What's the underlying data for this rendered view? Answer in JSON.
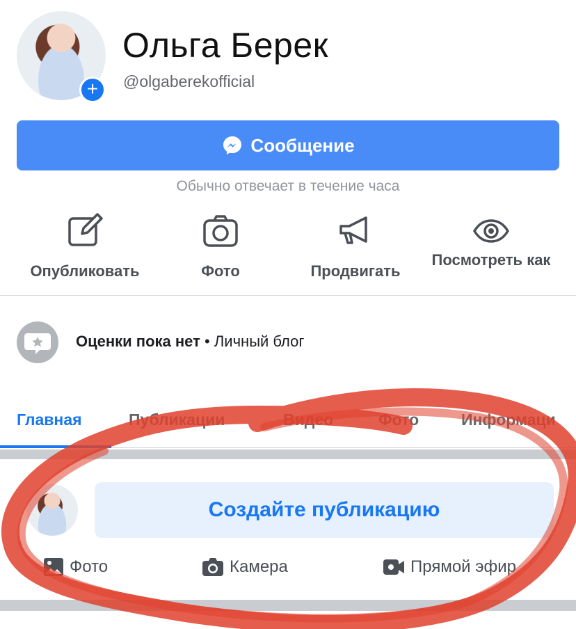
{
  "profile": {
    "name": "Ольга Берек",
    "handle": "@olgaberekofficial",
    "add_icon": "plus-icon"
  },
  "message": {
    "label": "Сообщение",
    "icon": "messenger-icon",
    "reply_note": "Обычно отвечает в течение часа"
  },
  "actions": [
    {
      "label": "Опубликовать",
      "icon": "edit-icon"
    },
    {
      "label": "Фото",
      "icon": "camera-icon"
    },
    {
      "label": "Продвигать",
      "icon": "megaphone-icon"
    },
    {
      "label": "Посмотреть как",
      "icon": "eye-icon"
    }
  ],
  "rating": {
    "title": "Оценки пока нет",
    "separator": "•",
    "category": "Личный блог",
    "icon": "review-star-icon"
  },
  "tabs": [
    {
      "label": "Главная",
      "active": true
    },
    {
      "label": "Публикации",
      "active": false
    },
    {
      "label": "Видео",
      "active": false
    },
    {
      "label": "Фото",
      "active": false
    },
    {
      "label": "Информаци",
      "active": false
    }
  ],
  "composer": {
    "prompt": "Создайте публикацию",
    "actions": [
      {
        "label": "Фото",
        "icon": "photo-icon"
      },
      {
        "label": "Камера",
        "icon": "camera-icon"
      },
      {
        "label": "Прямой эфир",
        "icon": "live-video-icon"
      }
    ]
  },
  "colors": {
    "accent": "#1877f2",
    "message_button": "#4a8cf7",
    "annotation_stroke": "#e0412d"
  }
}
